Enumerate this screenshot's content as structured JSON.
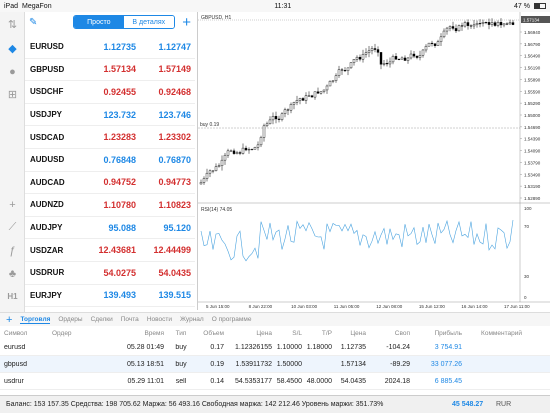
{
  "status": {
    "carrier": "MegaFon",
    "time": "11:31",
    "battery": "47 %"
  },
  "quotes": {
    "tab_simple": "Просто",
    "tab_detail": "В деталях",
    "rows": [
      {
        "symbol": "EURUSD",
        "bid": "1.12735",
        "ask": "1.12747",
        "dir": "up"
      },
      {
        "symbol": "GBPUSD",
        "bid": "1.57134",
        "ask": "1.57149",
        "dir": "dn"
      },
      {
        "symbol": "USDCHF",
        "bid": "0.92455",
        "ask": "0.92468",
        "dir": "dn"
      },
      {
        "symbol": "USDJPY",
        "bid": "123.732",
        "ask": "123.746",
        "dir": "up"
      },
      {
        "symbol": "USDCAD",
        "bid": "1.23283",
        "ask": "1.23302",
        "dir": "dn"
      },
      {
        "symbol": "AUDUSD",
        "bid": "0.76848",
        "ask": "0.76870",
        "dir": "up"
      },
      {
        "symbol": "AUDCAD",
        "bid": "0.94752",
        "ask": "0.94773",
        "dir": "dn"
      },
      {
        "symbol": "AUDNZD",
        "bid": "1.10780",
        "ask": "1.10823",
        "dir": "dn"
      },
      {
        "symbol": "AUDJPY",
        "bid": "95.088",
        "ask": "95.120",
        "dir": "up"
      },
      {
        "symbol": "USDZAR",
        "bid": "12.43681",
        "ask": "12.44499",
        "dir": "dn"
      },
      {
        "symbol": "USDRUR",
        "bid": "54.0275",
        "ask": "54.0435",
        "dir": "dn"
      },
      {
        "symbol": "EURJPY",
        "bid": "139.493",
        "ask": "139.515",
        "dir": "up"
      }
    ]
  },
  "chart": {
    "symbol_label": "GBPUSD, H1",
    "price_tag": "1.57134",
    "buy_label": "buy 0.19",
    "rsi_label": "RSI(14) 74.05",
    "price_ticks": [
      "1.56940",
      "1.56790",
      "1.56490",
      "1.56190",
      "1.55890",
      "1.55590",
      "1.55290",
      "1.55000",
      "1.54690",
      "1.54390",
      "1.54090",
      "1.53790",
      "1.53490",
      "1.53190",
      "1.52890"
    ],
    "rsi_ticks": [
      "100",
      "70",
      "30",
      "0"
    ],
    "time_ticks": [
      "5 Jun 15:00",
      "8 Jun 22:00",
      "10 Jun 03:00",
      "11 Jun 05:00",
      "12 Jun 08:00",
      "15 Jun 12:00",
      "16 Jun 14:00",
      "17 Jun 11:00"
    ]
  },
  "bottom_tabs": [
    "Торговля",
    "Ордеры",
    "Сделки",
    "Почта",
    "Новости",
    "Журнал",
    "О программе"
  ],
  "table": {
    "headers": [
      "Символ",
      "Ордер",
      "Время",
      "Тип",
      "Объем",
      "Цена",
      "S/L",
      "T/P",
      "Цена",
      "Своп",
      "Прибыль",
      "Комментарий"
    ],
    "rows": [
      {
        "sym": "eurusd",
        "order": "",
        "time": "05.28 01:49",
        "type": "buy",
        "vol": "0.17",
        "price": "1.12326155",
        "sl": "1.10000",
        "tp": "1.18000",
        "cur": "1.12735",
        "swap": "-104.24",
        "profit": "3 754.91",
        "comment": ""
      },
      {
        "sym": "gbpusd",
        "order": "",
        "time": "05.13 18:51",
        "type": "buy",
        "vol": "0.19",
        "price": "1.53911732",
        "sl": "1.50000",
        "tp": "",
        "cur": "1.57134",
        "swap": "-89.29",
        "profit": "33 077.26",
        "comment": ""
      },
      {
        "sym": "usdrur",
        "order": "",
        "time": "05.29 11:01",
        "type": "sell",
        "vol": "0.14",
        "price": "54.5353177",
        "sl": "58.4500",
        "tp": "48.0000",
        "cur": "54.0435",
        "swap": "2024.18",
        "profit": "6 885.45",
        "comment": ""
      }
    ]
  },
  "footer": {
    "summary": "Баланс: 153 157.35 Средства: 198 705.62 Маржа: 56 493.16 Свободная маржа: 142 212.46 Уровень маржи: 351.73%",
    "total": "45 548.27",
    "currency": "RUR"
  },
  "colors": {
    "accent": "#1e88e5",
    "down": "#d32f2f"
  }
}
